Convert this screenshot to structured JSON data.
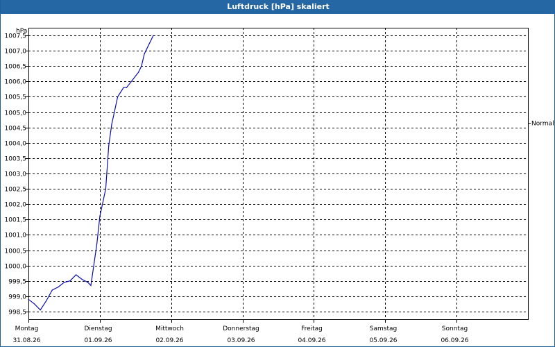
{
  "window": {
    "title": "Luftdruck [hPa] skaliert"
  },
  "colors": {
    "titlebar": "#2566a5",
    "line": "#0b0bb0",
    "grid": "#000000"
  },
  "chart_data": {
    "type": "line",
    "title": "Luftdruck [hPa] skaliert",
    "ylabel": "hPa",
    "ylim": [
      998.25,
      1007.75
    ],
    "xlim": [
      "2026-08-31T00:00",
      "2026-09-07T00:00"
    ],
    "yticks": [
      998.5,
      999.0,
      999.5,
      1000.0,
      1000.5,
      1001.0,
      1001.5,
      1002.0,
      1002.5,
      1003.0,
      1003.5,
      1004.0,
      1004.5,
      1005.0,
      1005.5,
      1006.0,
      1006.5,
      1007.0,
      1007.5
    ],
    "ytick_labels": [
      "998,5",
      "999,0",
      "999,5",
      "1000,0",
      "1000,5",
      "1001,0",
      "1001,5",
      "1002,0",
      "1002,5",
      "1003,0",
      "1003,5",
      "1004,0",
      "1004,5",
      "1005,0",
      "1005,5",
      "1006,0",
      "1006,5",
      "1007,0",
      "1007,5"
    ],
    "xtick_days": [
      "Montag",
      "Dienstag",
      "Mittwoch",
      "Donnerstag",
      "Freitag",
      "Samstag",
      "Sonntag"
    ],
    "xtick_dates": [
      "31.08.26",
      "01.09.26",
      "02.09.26",
      "03.09.26",
      "04.09.26",
      "05.09.26",
      "06.09.26"
    ],
    "grid": true,
    "reference": {
      "label": "Normal",
      "value": 1004.65
    },
    "series": [
      {
        "x": [
          "2026-08-31T00:00",
          "2026-08-31T02:00",
          "2026-08-31T04:00",
          "2026-08-31T06:00",
          "2026-08-31T08:00",
          "2026-08-31T10:00",
          "2026-08-31T12:00",
          "2026-08-31T14:00",
          "2026-08-31T16:00",
          "2026-08-31T18:00",
          "2026-08-31T20:00",
          "2026-08-31T21:00",
          "2026-08-31T23:00",
          "2026-09-01T00:00",
          "2026-09-01T02:00",
          "2026-09-01T03:00",
          "2026-09-01T04:00",
          "2026-09-01T06:00",
          "2026-09-01T08:00",
          "2026-09-01T09:00",
          "2026-09-01T11:00",
          "2026-09-01T13:00",
          "2026-09-01T14:00",
          "2026-09-01T15:00",
          "2026-09-01T17:00",
          "2026-09-01T18:00"
        ],
        "values": [
          998.9,
          998.75,
          998.55,
          998.85,
          999.2,
          999.3,
          999.45,
          999.5,
          999.7,
          999.55,
          999.45,
          999.35,
          1000.7,
          1001.6,
          1002.5,
          1003.9,
          1004.6,
          1005.5,
          1005.8,
          1005.8,
          1006.05,
          1006.3,
          1006.5,
          1006.9,
          1007.3,
          1007.5
        ]
      }
    ]
  }
}
